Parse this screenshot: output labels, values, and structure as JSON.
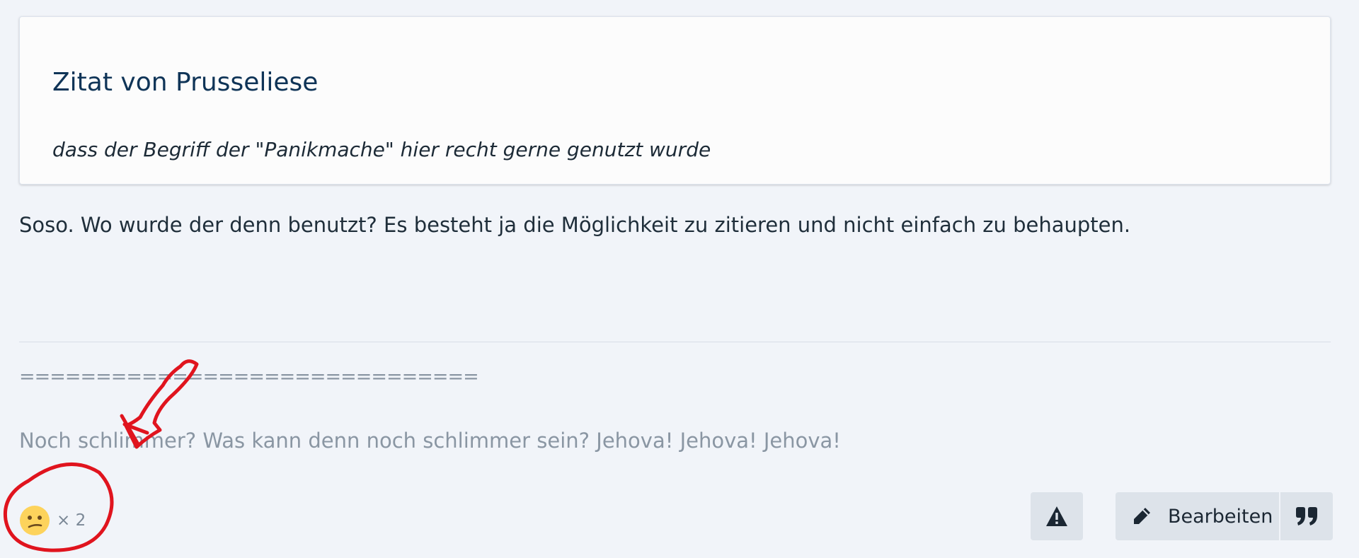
{
  "quote": {
    "title": "Zitat von Prusseliese",
    "text": "dass der Begriff der \"Panikmache\" hier recht gerne genutzt wurde"
  },
  "message": "Soso. Wo wurde der denn benutzt? Es besteht ja die Möglichkeit zu zitieren und nicht einfach zu behaupten.",
  "signature": {
    "separator": "==============================",
    "text": "Noch schlimmer? Was kann denn noch schlimmer sein? Jehova! Jehova! Jehova!"
  },
  "reaction": {
    "icon": "confused-face-icon",
    "count_label": "× 2"
  },
  "actions": {
    "report_icon": "warning-icon",
    "edit_icon": "pencil-icon",
    "edit_label": "Bearbeiten",
    "quote_icon": "quote-icon"
  },
  "annotation": {
    "color": "#e0141e"
  }
}
